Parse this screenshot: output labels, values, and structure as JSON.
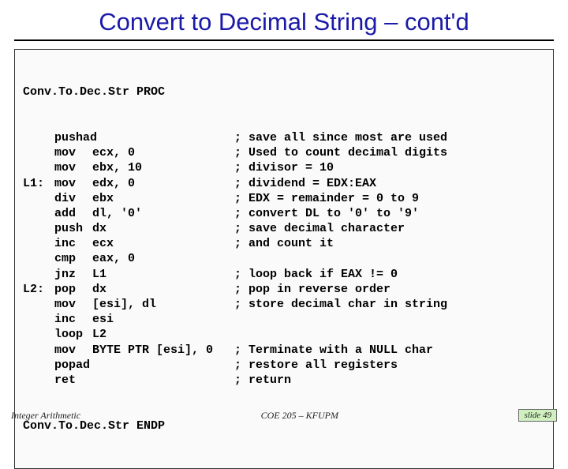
{
  "title": "Convert to Decimal String – cont'd",
  "proc_start": "Conv.To.Dec.Str PROC",
  "proc_end": "Conv.To.Dec.Str ENDP",
  "lines": [
    {
      "lbl": "",
      "op": "pushad",
      "arg": "",
      "cmt": "; save all since most are used"
    },
    {
      "lbl": "",
      "op": "mov",
      "arg": "ecx, 0",
      "cmt": "; Used to count decimal digits"
    },
    {
      "lbl": "",
      "op": "mov",
      "arg": "ebx, 10",
      "cmt": "; divisor = 10"
    },
    {
      "lbl": "L1:",
      "op": "mov",
      "arg": "edx, 0",
      "cmt": "; dividend = EDX:EAX"
    },
    {
      "lbl": "",
      "op": "div",
      "arg": "ebx",
      "cmt": "; EDX = remainder = 0 to 9"
    },
    {
      "lbl": "",
      "op": "add",
      "arg": "dl, '0'",
      "cmt": "; convert DL to '0' to '9'"
    },
    {
      "lbl": "",
      "op": "push",
      "arg": "dx",
      "cmt": "; save decimal character"
    },
    {
      "lbl": "",
      "op": "inc",
      "arg": "ecx",
      "cmt": "; and count it"
    },
    {
      "lbl": "",
      "op": "cmp",
      "arg": "eax, 0",
      "cmt": ""
    },
    {
      "lbl": "",
      "op": "jnz",
      "arg": "L1",
      "cmt": "; loop back if EAX != 0"
    },
    {
      "lbl": "L2:",
      "op": "pop",
      "arg": "dx",
      "cmt": "; pop in reverse order"
    },
    {
      "lbl": "",
      "op": "mov",
      "arg": "[esi], dl",
      "cmt": "; store decimal char in string"
    },
    {
      "lbl": "",
      "op": "inc",
      "arg": "esi",
      "cmt": ""
    },
    {
      "lbl": "",
      "op": "loop",
      "arg": "L2",
      "cmt": ""
    },
    {
      "lbl": "",
      "op": "mov",
      "arg": "BYTE PTR [esi], 0",
      "cmt": "; Terminate with a NULL char"
    },
    {
      "lbl": "",
      "op": "popad",
      "arg": "",
      "cmt": "; restore all registers"
    },
    {
      "lbl": "",
      "op": "ret",
      "arg": "",
      "cmt": "; return"
    }
  ],
  "footer": {
    "left": "Integer Arithmetic",
    "center": "COE 205 – KFUPM",
    "right": "slide 49"
  }
}
